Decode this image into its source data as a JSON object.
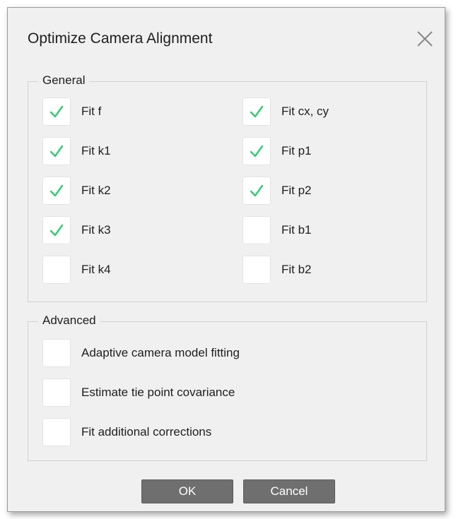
{
  "dialog": {
    "title": "Optimize Camera Alignment"
  },
  "general": {
    "legend": "General",
    "left": [
      {
        "label": "Fit f",
        "checked": true
      },
      {
        "label": "Fit k1",
        "checked": true
      },
      {
        "label": "Fit k2",
        "checked": true
      },
      {
        "label": "Fit k3",
        "checked": true
      },
      {
        "label": "Fit k4",
        "checked": false
      }
    ],
    "right": [
      {
        "label": "Fit cx, cy",
        "checked": true
      },
      {
        "label": "Fit p1",
        "checked": true
      },
      {
        "label": "Fit p2",
        "checked": true
      },
      {
        "label": "Fit b1",
        "checked": false
      },
      {
        "label": "Fit b2",
        "checked": false
      }
    ]
  },
  "advanced": {
    "legend": "Advanced",
    "items": [
      {
        "label": "Adaptive camera model fitting",
        "checked": false
      },
      {
        "label": "Estimate tie point covariance",
        "checked": false
      },
      {
        "label": "Fit additional corrections",
        "checked": false
      }
    ]
  },
  "buttons": {
    "ok": "OK",
    "cancel": "Cancel"
  },
  "colors": {
    "checkmark": "#2ecc71",
    "button_bg": "#6f6f6f"
  },
  "icons": {
    "close": "close-icon",
    "check": "checkmark-icon"
  }
}
